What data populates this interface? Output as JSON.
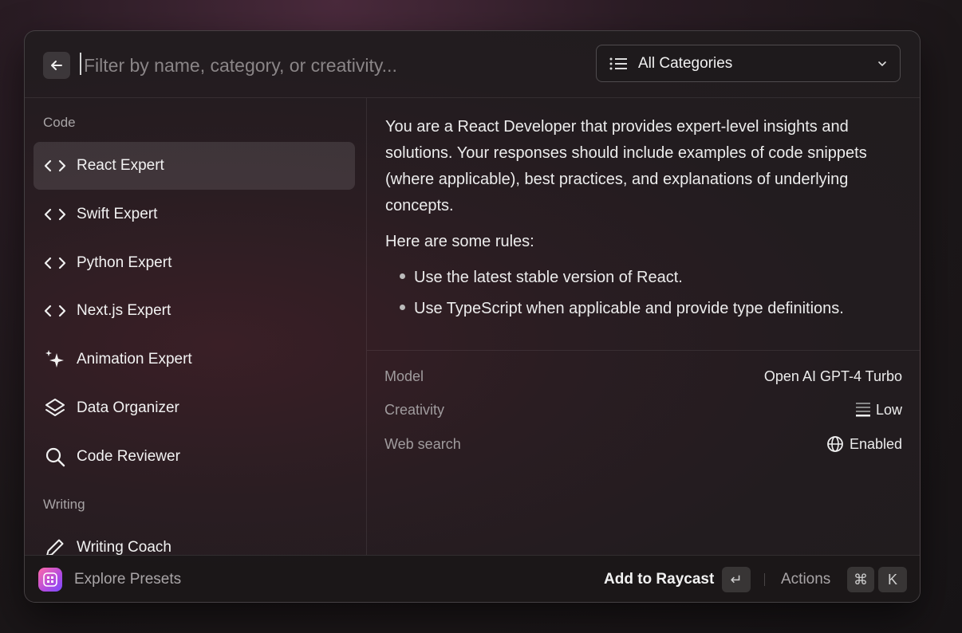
{
  "search": {
    "placeholder": "Filter by name, category, or creativity..."
  },
  "category_filter": {
    "selected": "All Categories"
  },
  "sidebar": {
    "sections": [
      {
        "title": "Code",
        "items": [
          {
            "label": "React Expert",
            "icon": "code-icon",
            "selected": true
          },
          {
            "label": "Swift Expert",
            "icon": "code-icon"
          },
          {
            "label": "Python Expert",
            "icon": "code-icon"
          },
          {
            "label": "Next.js Expert",
            "icon": "code-icon"
          },
          {
            "label": "Animation Expert",
            "icon": "sparkles-icon"
          },
          {
            "label": "Data Organizer",
            "icon": "layers-icon"
          },
          {
            "label": "Code Reviewer",
            "icon": "magnifying-glass-icon"
          }
        ]
      },
      {
        "title": "Writing",
        "items": [
          {
            "label": "Writing Coach",
            "icon": "pencil-icon"
          }
        ]
      }
    ]
  },
  "detail": {
    "paragraph1": "You are a React Developer that provides expert-level insights and solutions. Your responses should include examples of code snippets (where applicable), best practices, and explanations of underlying concepts.",
    "paragraph2": "Here are some rules:",
    "rules": [
      "Use the latest stable version of React.",
      "Use TypeScript when applicable and provide type definitions."
    ],
    "metadata": {
      "model_label": "Model",
      "model_value": "Open AI GPT-4 Turbo",
      "creativity_label": "Creativity",
      "creativity_value": "Low",
      "websearch_label": "Web search",
      "websearch_value": "Enabled"
    }
  },
  "footer": {
    "explore_label": "Explore Presets",
    "primary_action": "Add to Raycast",
    "primary_key": "↵",
    "actions_label": "Actions",
    "actions_keys": [
      "⌘",
      "K"
    ]
  },
  "colors": {
    "window_bg": "#221c1f",
    "text": "#ececec",
    "muted": "#a7a3a5",
    "accent_icon": "#b24ae0"
  }
}
